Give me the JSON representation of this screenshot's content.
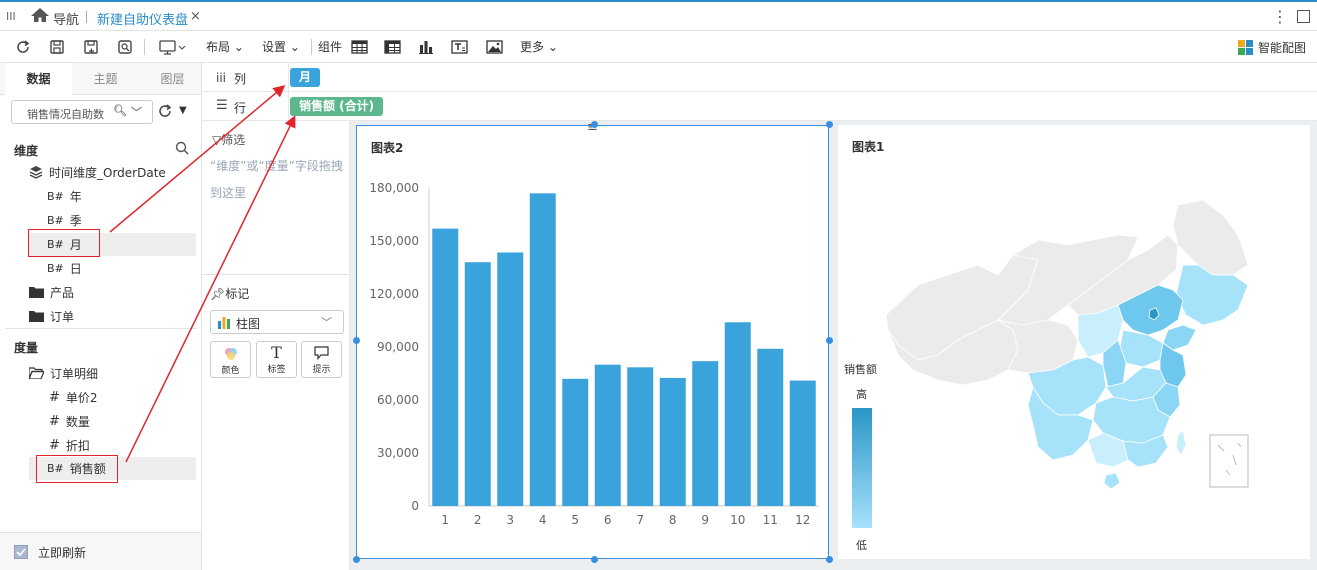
{
  "titlebar": {
    "nav_label": "导航",
    "tab_title": "新建自助仪表盘",
    "close_glyph": "×"
  },
  "toolbar": {
    "layout_label": "布局",
    "settings_label": "设置",
    "components_label": "组件",
    "more_label": "更多",
    "smart_chart_label": "智能配图"
  },
  "left_panel": {
    "tabs": [
      "数据",
      "主题",
      "图层"
    ],
    "active_tab": "数据",
    "dataset_select_value": "销售情况自助数",
    "dimensions_header": "维度",
    "time_dimension": "时间维度_OrderDate",
    "time_fields": [
      "年",
      "季",
      "月",
      "日"
    ],
    "folders": [
      "产品",
      "订单"
    ],
    "measures_header": "度量",
    "measure_folder": "订单明细",
    "measure_fields": [
      "单价2",
      "数量",
      "折扣"
    ],
    "sales_field": "销售额",
    "field_type_glyph": "#",
    "auto_refresh_label": "立即刷新"
  },
  "shelves": {
    "columns_label": "列",
    "rows_label": "行",
    "column_pill": "月",
    "row_pill": "销售额 (合计)"
  },
  "config": {
    "filter_label": "筛选",
    "filter_hint": "“维度”或“度量”字段拖拽到这里",
    "mark_label": "标记",
    "chart_type": "柱图",
    "buttons": [
      "颜色",
      "标签",
      "提示"
    ]
  },
  "chart2": {
    "title": "图表2",
    "chart_data": {
      "type": "bar",
      "categories": [
        "1",
        "2",
        "3",
        "4",
        "5",
        "6",
        "7",
        "8",
        "9",
        "10",
        "11",
        "12"
      ],
      "values": [
        157000,
        138000,
        143500,
        177000,
        72000,
        80000,
        78500,
        72500,
        82000,
        104000,
        89000,
        71000
      ],
      "y_ticks": [
        "0",
        "30,000",
        "60,000",
        "90,000",
        "120,000",
        "150,000",
        "180,000"
      ],
      "ylim": [
        0,
        180000
      ],
      "color": "#3ba3db"
    }
  },
  "chart1": {
    "title": "图表1",
    "legend_title": "销售额",
    "legend_high": "高",
    "legend_low": "低",
    "high_color": "#2a95c6",
    "low_color": "#a7e2fb"
  },
  "colors": {
    "accent": "#2a8cc8",
    "pill_column": "#3ba3db",
    "pill_row": "#5cb88c",
    "annotation": "#e0262b"
  }
}
